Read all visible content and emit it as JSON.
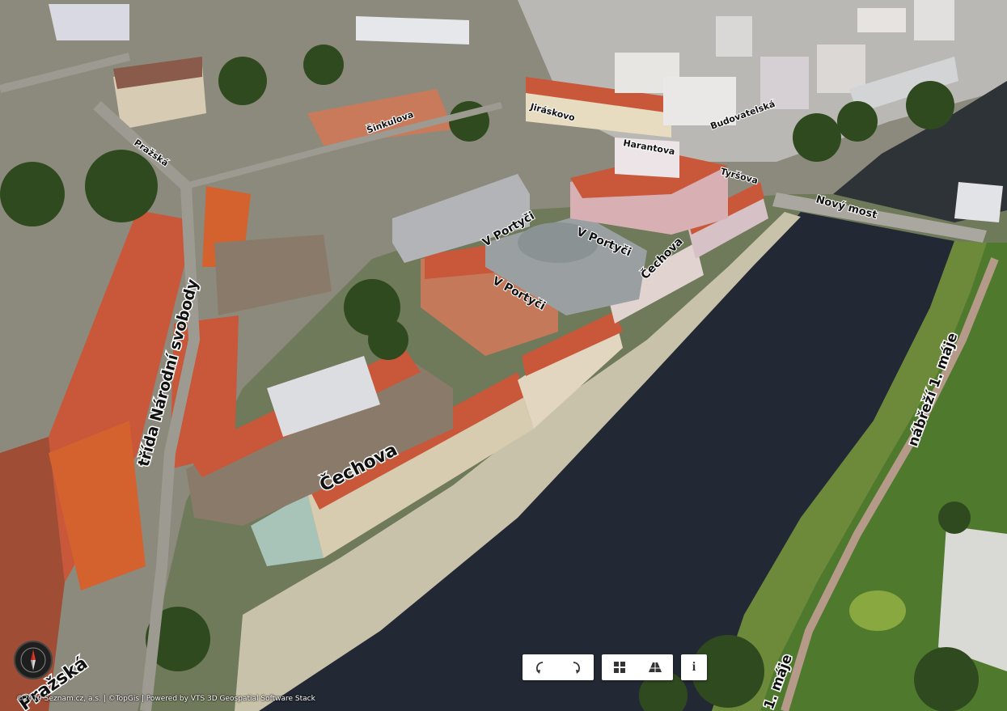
{
  "map": {
    "labels": {
      "cechova_main": "Čechova",
      "trida_narodni_svobody": "třída Národní svobody",
      "v_portyci_1": "V Portyči",
      "v_portyci_2": "V Portyči",
      "v_portyci_3": "V Portyči",
      "cechova_small": "Čechova",
      "novy_most": "Nový most",
      "nabrezi_1_maje": "nábřeží 1. máje",
      "maje_bottom": "1. máje",
      "bottom_left_street": "Pražská",
      "tyrsova": "Tyršova",
      "harantova": "Harantova",
      "prazska_small": "Pražská",
      "budovatelska": "Budovatelská",
      "sinkulova": "Šinkulova",
      "jiraskovo": "Jiráskovo"
    }
  },
  "controls": {
    "rotate_left_icon": "rotate-left-icon",
    "rotate_right_icon": "rotate-right-icon",
    "view_2d_icon": "grid-icon",
    "view_3d_icon": "perspective-icon",
    "info_label": "i"
  },
  "compass": {
    "icon": "compass-icon"
  },
  "copyright": "©2019 Seznam.cz, a.s. | ©TopGis | Powered by VTS 3D Geospatial Software Stack",
  "colors": {
    "river": "#222833",
    "roof": "#c9573a",
    "grass": "#5b7a33",
    "control_bg": "#ffffff"
  }
}
